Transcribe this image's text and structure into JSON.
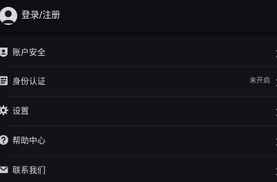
{
  "header": {
    "login_label": "登录/注册",
    "avatar_icon": "user-avatar-icon"
  },
  "menu": {
    "items": [
      {
        "key": "account-security",
        "label": "账户安全",
        "icon": "lock-user-icon",
        "value": ""
      },
      {
        "key": "identity-verification",
        "label": "身份认证",
        "icon": "id-card-icon",
        "value": "未开启"
      },
      {
        "key": "settings",
        "label": "设置",
        "icon": "gear-icon",
        "value": ""
      },
      {
        "key": "help-center",
        "label": "帮助中心",
        "icon": "question-icon",
        "value": ""
      },
      {
        "key": "contact-us",
        "label": "联系我们",
        "icon": "mail-icon",
        "value": ""
      }
    ]
  },
  "colors": {
    "background": "#111318",
    "header_background": "#0d0f13",
    "text_primary": "#d9dbe0",
    "text_secondary": "#a6a9b0",
    "icon": "#c8cad0"
  }
}
